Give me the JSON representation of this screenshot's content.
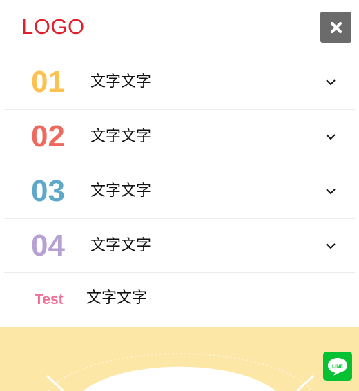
{
  "header": {
    "logo_text": "LOGO"
  },
  "menu": {
    "items": [
      {
        "number": "01",
        "label": "文字文字",
        "color": "#fcc150"
      },
      {
        "number": "02",
        "label": "文字文字",
        "color": "#ec6a5e"
      },
      {
        "number": "03",
        "label": "文字文字",
        "color": "#5fa9c8"
      },
      {
        "number": "04",
        "label": "文字文字",
        "color": "#b7a0d2"
      }
    ],
    "extra": {
      "label": "Test",
      "text": "文字文字",
      "color": "#ef7096"
    }
  },
  "line_button": {
    "label": "LINE",
    "color": "#06c233"
  },
  "icons": {
    "close": "close-icon",
    "chevron": "chevron-down-icon",
    "line": "line-chat-icon"
  }
}
